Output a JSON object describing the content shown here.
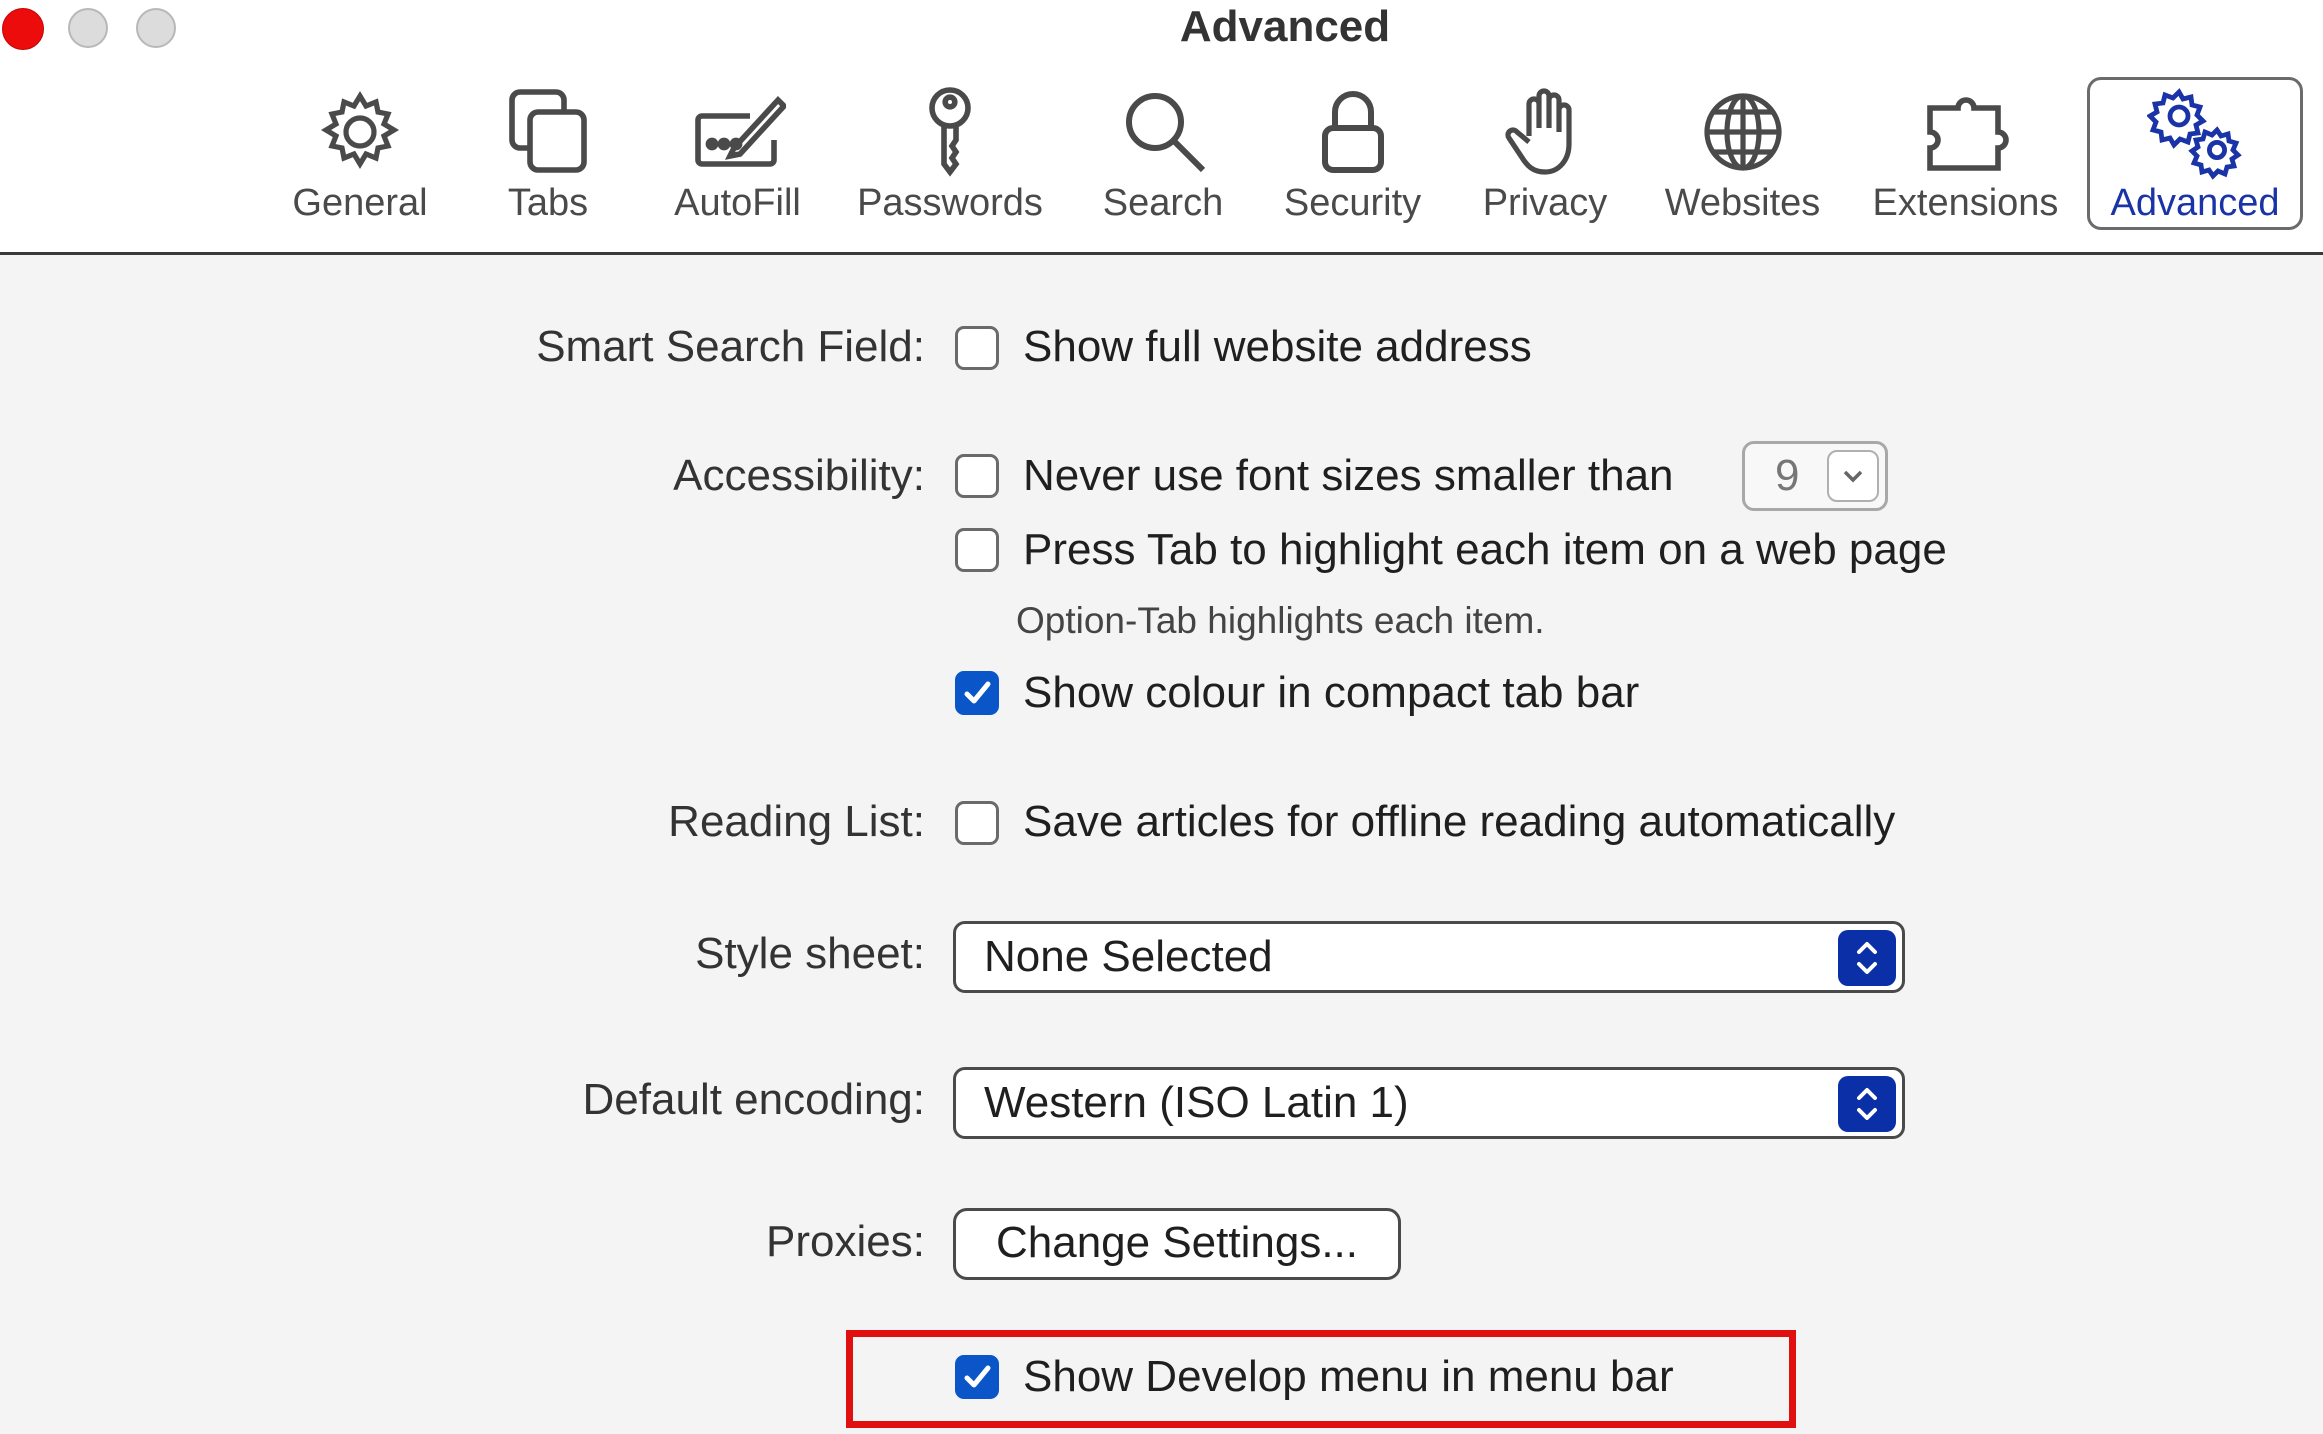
{
  "window": {
    "title": "Advanced",
    "controls": [
      "close",
      "minimize",
      "zoom"
    ]
  },
  "toolbar": {
    "tabs": [
      {
        "label": "General",
        "icon": "gear-icon"
      },
      {
        "label": "Tabs",
        "icon": "tabs-icon"
      },
      {
        "label": "AutoFill",
        "icon": "autofill-pen-icon"
      },
      {
        "label": "Passwords",
        "icon": "key-icon"
      },
      {
        "label": "Search",
        "icon": "magnifier-icon"
      },
      {
        "label": "Security",
        "icon": "lock-icon"
      },
      {
        "label": "Privacy",
        "icon": "hand-icon"
      },
      {
        "label": "Websites",
        "icon": "globe-icon"
      },
      {
        "label": "Extensions",
        "icon": "puzzle-icon"
      },
      {
        "label": "Advanced",
        "icon": "gears-icon"
      }
    ],
    "selected": "Advanced"
  },
  "settings": {
    "smart_search": {
      "label": "Smart Search Field:",
      "option": "Show full website address",
      "checked": false
    },
    "accessibility": {
      "label": "Accessibility:",
      "font_size_option": "Never use font sizes smaller than",
      "font_size_checked": false,
      "font_size_value": "9",
      "tab_option": "Press Tab to highlight each item on a web page",
      "tab_checked": false,
      "tab_hint": "Option-Tab highlights each item.",
      "colour_option": "Show colour in compact tab bar",
      "colour_checked": true
    },
    "reading_list": {
      "label": "Reading List:",
      "option": "Save articles for offline reading automatically",
      "checked": false
    },
    "style_sheet": {
      "label": "Style sheet:",
      "value": "None Selected"
    },
    "default_encoding": {
      "label": "Default encoding:",
      "value": "Western (ISO Latin 1)"
    },
    "proxies": {
      "label": "Proxies:",
      "button": "Change Settings..."
    },
    "develop_menu": {
      "option": "Show Develop menu in menu bar",
      "checked": true
    }
  },
  "colors": {
    "accent": "#0a55c8",
    "selected_tab_text": "#1a33a6",
    "highlight_box": "#e01010",
    "close_button": "#ec0c0c"
  }
}
